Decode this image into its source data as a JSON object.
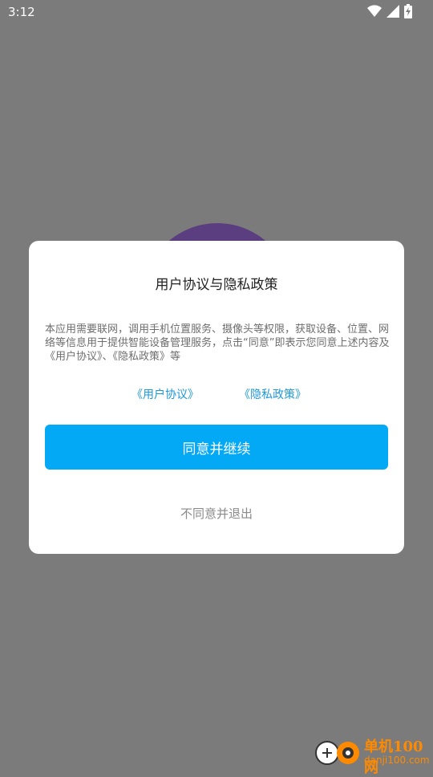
{
  "status_bar": {
    "time": "3:12",
    "icons": [
      "wifi-icon",
      "signal-icon",
      "battery-charging-icon"
    ]
  },
  "dialog": {
    "title": "用户协议与隐私政策",
    "body": "本应用需要联网，调用手机位置服务、摄像头等权限，获取设备、位置、网络等信息用于提供智能设备管理服务，点击“同意”即表示您同意上述内容及《用户协议》、《隐私政策》等",
    "links": {
      "user_agreement": "《用户协议》",
      "privacy_policy": "《隐私政策》"
    },
    "agree_label": "同意并继续",
    "decline_label": "不同意并退出"
  },
  "watermark": {
    "title": "单机100网",
    "url": "danji100.com"
  },
  "colors": {
    "accent": "#03a9f4",
    "link": "#1f98d8",
    "overlay": "#7b7b7b",
    "background_circle": "#5b3e7f"
  }
}
